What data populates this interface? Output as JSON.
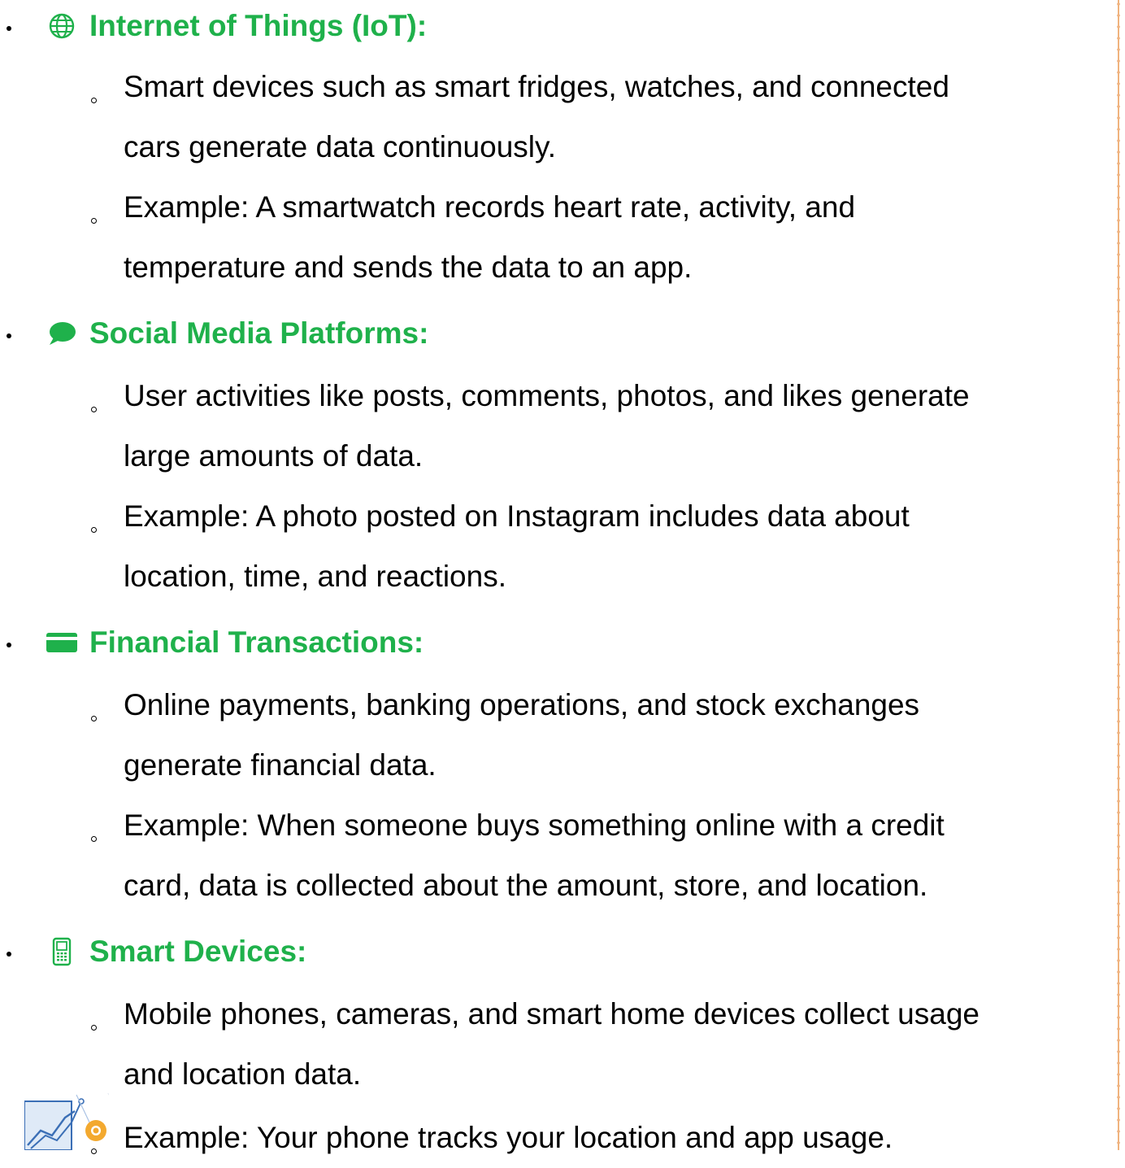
{
  "colors": {
    "heading": "#1fb14b",
    "icon": "#1fb14b",
    "text": "#000000",
    "border": "#ea9a5a"
  },
  "sections": [
    {
      "icon": "globe-icon",
      "title": "Internet of Things (IoT):",
      "items": [
        {
          "lines": [
            "Smart devices such as smart fridges, watches, and connected",
            "cars generate data continuously."
          ]
        },
        {
          "lines": [
            "Example: A smartwatch records heart rate, activity, and",
            "temperature and sends the data to an app."
          ]
        }
      ]
    },
    {
      "icon": "speech-bubble-icon",
      "title": "Social Media Platforms:",
      "items": [
        {
          "lines": [
            "User activities like posts, comments, photos, and likes generate",
            "large amounts of data."
          ]
        },
        {
          "lines": [
            "Example: A photo posted on Instagram includes data about",
            "location, time, and reactions."
          ]
        }
      ]
    },
    {
      "icon": "credit-card-icon",
      "title": "Financial Transactions:",
      "items": [
        {
          "lines": [
            "Online payments, banking operations, and stock exchanges",
            "generate financial data."
          ]
        },
        {
          "lines": [
            "Example: When someone buys something online with a credit",
            "card, data is collected about the amount, store, and location."
          ]
        }
      ]
    },
    {
      "icon": "mobile-phone-icon",
      "title": "Smart Devices:",
      "items": [
        {
          "lines": [
            "Mobile phones, cameras, and smart home devices collect usage",
            "and location data."
          ]
        },
        {
          "lines": [
            "Example: Your phone tracks your location and app usage."
          ]
        }
      ]
    }
  ]
}
